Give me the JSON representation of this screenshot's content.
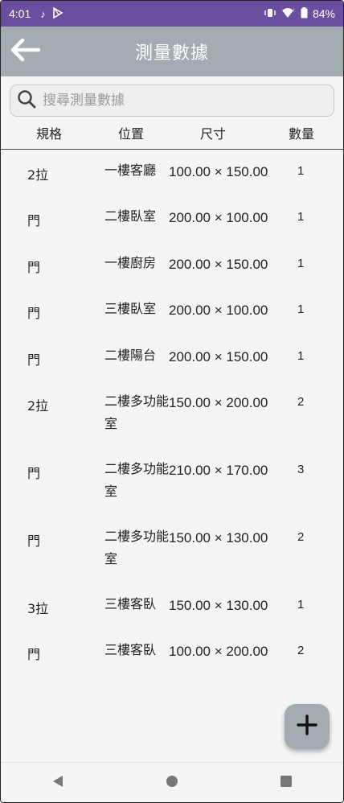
{
  "status": {
    "time": "4:01",
    "battery": "84%"
  },
  "appbar": {
    "title": "測量數據"
  },
  "search": {
    "placeholder": "搜尋測量數據",
    "value": ""
  },
  "columns": [
    "規格",
    "位置",
    "尺寸",
    "數量"
  ],
  "rows": [
    {
      "spec": "2拉",
      "loc": "一樓客廳",
      "size": "100.00 × 150.00",
      "qty": "1"
    },
    {
      "spec": "門",
      "loc": "二樓臥室",
      "size": "200.00 × 100.00",
      "qty": "1"
    },
    {
      "spec": "門",
      "loc": "一樓廚房",
      "size": "200.00 × 150.00",
      "qty": "1"
    },
    {
      "spec": "門",
      "loc": "三樓臥室",
      "size": "200.00 × 100.00",
      "qty": "1"
    },
    {
      "spec": "門",
      "loc": "二樓陽台",
      "size": "200.00 × 150.00",
      "qty": "1"
    },
    {
      "spec": "2拉",
      "loc": "二樓多功能室",
      "size": "150.00 × 200.00",
      "qty": "2"
    },
    {
      "spec": "門",
      "loc": "二樓多功能室",
      "size": "210.00 × 170.00",
      "qty": "3"
    },
    {
      "spec": "門",
      "loc": "二樓多功能室",
      "size": "150.00 × 130.00",
      "qty": "2"
    },
    {
      "spec": "3拉",
      "loc": "三樓客臥",
      "size": "150.00 × 130.00",
      "qty": "1"
    },
    {
      "spec": "門",
      "loc": "三樓客臥",
      "size": "100.00 × 200.00",
      "qty": "2"
    }
  ],
  "colors": {
    "statusbar": "#6a4fa0",
    "appbar": "#a3acb1"
  },
  "icons": {
    "back": "arrow-left-icon",
    "search": "search-icon",
    "fab": "plus-icon"
  }
}
